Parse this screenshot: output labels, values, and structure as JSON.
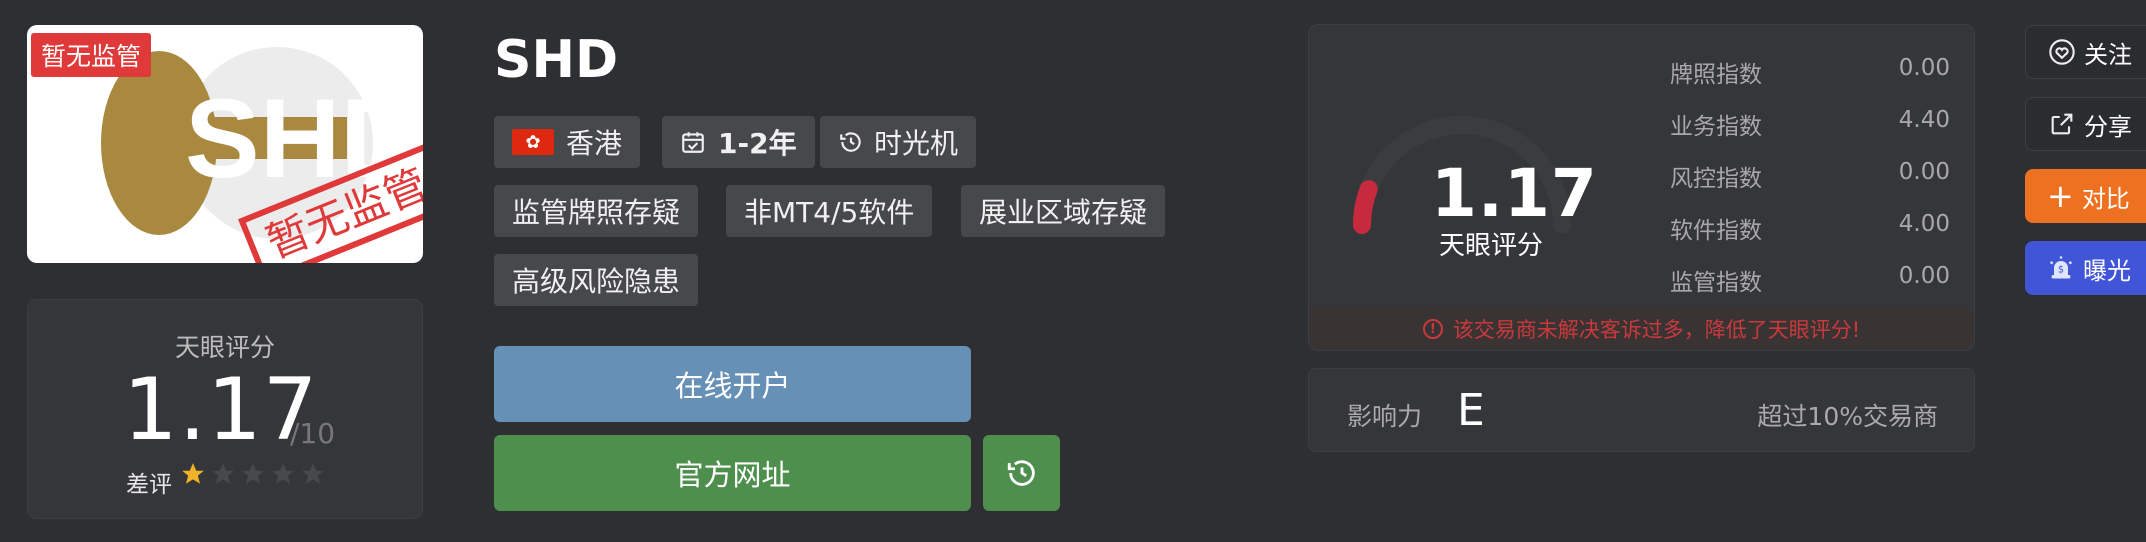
{
  "broker": {
    "name": "SHD",
    "regulation_badge": "暂无监管",
    "logo_text": "SHD",
    "stamp_text": "暂无监管"
  },
  "score_card": {
    "label": "天眼评分",
    "score": "1.17",
    "max": "/10",
    "rating_word": "差评",
    "stars_filled": 1,
    "stars_total": 5
  },
  "tags": {
    "region": "香港",
    "years": "1-2年",
    "time_machine": "时光机",
    "t1": "监管牌照存疑",
    "t2": "非MT4/5软件",
    "t3": "展业区域存疑",
    "t4": "高级风险隐患"
  },
  "buttons": {
    "open_account": "在线开户",
    "official_site": "官方网址"
  },
  "panel": {
    "score": "1.17",
    "score_label": "天眼评分",
    "gauge_fraction": 0.117,
    "indices": [
      {
        "name": "牌照指数",
        "value": "0.00"
      },
      {
        "name": "业务指数",
        "value": "4.40"
      },
      {
        "name": "风控指数",
        "value": "0.00"
      },
      {
        "name": "软件指数",
        "value": "4.00"
      },
      {
        "name": "监管指数",
        "value": "0.00"
      }
    ],
    "warning": "该交易商未解决客诉过多，降低了天眼评分!"
  },
  "impact": {
    "label": "影响力",
    "grade": "E",
    "percentile": "超过10%交易商"
  },
  "side": {
    "follow": "关注",
    "share": "分享",
    "compare": "对比",
    "expose": "曝光"
  },
  "colors": {
    "background": "#2e2f33",
    "open_button": "#6790b6",
    "site_button": "#4e8f4d",
    "warning": "#c9393c",
    "compare": "#ee7021",
    "expose": "#4155d9",
    "badge": "#e0393a",
    "logo_gold": "#a8893f"
  }
}
